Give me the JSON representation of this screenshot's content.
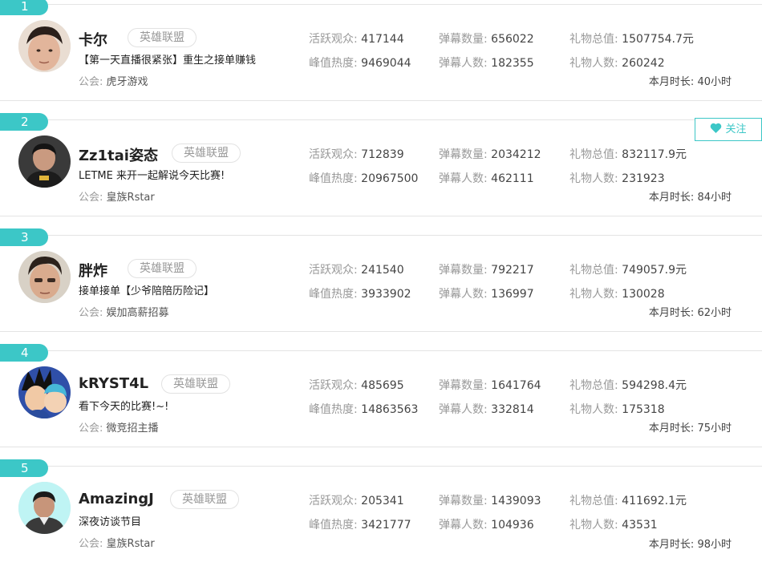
{
  "colors": {
    "accent": "#3cc7c7",
    "muted": "#999999",
    "text": "#333333"
  },
  "cards": [
    {
      "rank": "1",
      "name": "卡尔",
      "category": "英雄联盟",
      "title": "【第一天直播很紧张】重生之接单赚钱",
      "guild_label": "公会:",
      "guild": "虎牙游戏",
      "active_viewers_label": "活跃观众:",
      "active_viewers": "417144",
      "peak_heat_label": "峰值热度:",
      "peak_heat": "9469044",
      "danmu_count_label": "弹幕数量:",
      "danmu_count": "656022",
      "danmu_users_label": "弹幕人数:",
      "danmu_users": "182355",
      "gift_value_label": "礼物总值:",
      "gift_value": "1507754.7元",
      "gift_users_label": "礼物人数:",
      "gift_users": "260242",
      "monthly_hours_label": "本月时长:",
      "monthly_hours": "40小时",
      "avatar_icon": "avatar-boy-icon"
    },
    {
      "rank": "2",
      "name": "Zz1tai姿态",
      "category": "英雄联盟",
      "title": "LETME 来开一起解说今天比赛!",
      "guild_label": "公会:",
      "guild": "皇族Rstar",
      "active_viewers_label": "活跃观众:",
      "active_viewers": "712839",
      "peak_heat_label": "峰值热度:",
      "peak_heat": "20967500",
      "danmu_count_label": "弹幕数量:",
      "danmu_count": "2034212",
      "danmu_users_label": "弹幕人数:",
      "danmu_users": "462111",
      "gift_value_label": "礼物总值:",
      "gift_value": "832117.9元",
      "gift_users_label": "礼物人数:",
      "gift_users": "231923",
      "monthly_hours_label": "本月时长:",
      "monthly_hours": "84小时",
      "follow_label": "关注",
      "avatar_icon": "avatar-player-icon"
    },
    {
      "rank": "3",
      "name": "胖炸",
      "category": "英雄联盟",
      "title": "接单接单【少爷陪陪历险记】",
      "guild_label": "公会:",
      "guild": "娱加高薪招募",
      "active_viewers_label": "活跃观众:",
      "active_viewers": "241540",
      "peak_heat_label": "峰值热度:",
      "peak_heat": "3933902",
      "danmu_count_label": "弹幕数量:",
      "danmu_count": "792217",
      "danmu_users_label": "弹幕人数:",
      "danmu_users": "136997",
      "gift_value_label": "礼物总值:",
      "gift_value": "749057.9元",
      "gift_users_label": "礼物人数:",
      "gift_users": "130028",
      "monthly_hours_label": "本月时长:",
      "monthly_hours": "62小时",
      "avatar_icon": "avatar-young-man-icon"
    },
    {
      "rank": "4",
      "name": "kRYST4L",
      "category": "英雄联盟",
      "title": "看下今天的比赛!~!",
      "guild_label": "公会:",
      "guild": "微竞招主播",
      "active_viewers_label": "活跃观众:",
      "active_viewers": "485695",
      "peak_heat_label": "峰值热度:",
      "peak_heat": "14863563",
      "danmu_count_label": "弹幕数量:",
      "danmu_count": "1641764",
      "danmu_users_label": "弹幕人数:",
      "danmu_users": "332814",
      "gift_value_label": "礼物总值:",
      "gift_value": "594298.4元",
      "gift_users_label": "礼物人数:",
      "gift_users": "175318",
      "monthly_hours_label": "本月时长:",
      "monthly_hours": "75小时",
      "avatar_icon": "avatar-anime-icon"
    },
    {
      "rank": "5",
      "name": "AmazingJ",
      "category": "英雄联盟",
      "title": "深夜访谈节目",
      "guild_label": "公会:",
      "guild": "皇族Rstar",
      "active_viewers_label": "活跃观众:",
      "active_viewers": "205341",
      "peak_heat_label": "峰值热度:",
      "peak_heat": "3421777",
      "danmu_count_label": "弹幕数量:",
      "danmu_count": "1439093",
      "danmu_users_label": "弹幕人数:",
      "danmu_users": "104936",
      "gift_value_label": "礼物总值:",
      "gift_value": "411692.1元",
      "gift_users_label": "礼物人数:",
      "gift_users": "43531",
      "monthly_hours_label": "本月时长:",
      "monthly_hours": "98小时",
      "avatar_icon": "avatar-man-icon"
    }
  ]
}
